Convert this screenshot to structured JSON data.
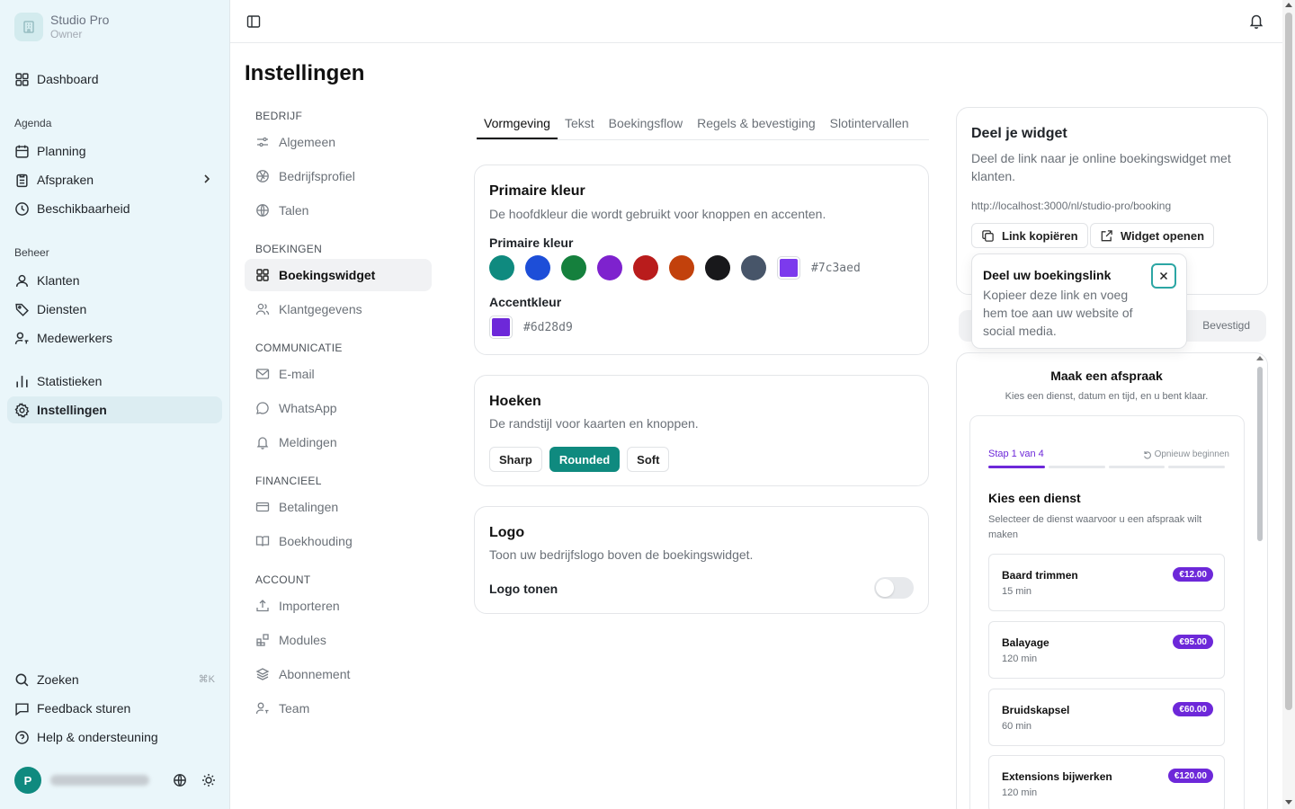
{
  "brand": {
    "name": "Studio Pro",
    "role": "Owner"
  },
  "sidebar": {
    "dashboard": "Dashboard",
    "agenda_title": "Agenda",
    "agenda": [
      "Planning",
      "Afspraken",
      "Beschikbaarheid"
    ],
    "beheer_title": "Beheer",
    "beheer": [
      "Klanten",
      "Diensten",
      "Medewerkers"
    ],
    "stats": "Statistieken",
    "settings": "Instellingen",
    "search": "Zoeken",
    "search_kbd": "⌘K",
    "feedback": "Feedback sturen",
    "help": "Help & ondersteuning",
    "user_initial": "P"
  },
  "page": {
    "title": "Instellingen"
  },
  "subnav": {
    "bedrijf": "BEDRIJF",
    "algemeen": "Algemeen",
    "bedrijfsprofiel": "Bedrijfsprofiel",
    "talen": "Talen",
    "boekingen": "BOEKINGEN",
    "boekingswidget": "Boekingswidget",
    "klantgegevens": "Klantgegevens",
    "communicatie": "COMMUNICATIE",
    "email": "E-mail",
    "whatsapp": "WhatsApp",
    "meldingen": "Meldingen",
    "financieel": "FINANCIEEL",
    "betalingen": "Betalingen",
    "boekhouding": "Boekhouding",
    "account": "ACCOUNT",
    "importeren": "Importeren",
    "modules": "Modules",
    "abonnement": "Abonnement",
    "team": "Team"
  },
  "tabs": [
    "Vormgeving",
    "Tekst",
    "Boekingsflow",
    "Regels & bevestiging",
    "Slotintervallen"
  ],
  "primary": {
    "title": "Primaire kleur",
    "desc": "De hoofdkleur die wordt gebruikt voor knoppen en accenten.",
    "label": "Primaire kleur",
    "swatches": [
      "#0f8a7f",
      "#1d4ed8",
      "#15803d",
      "#7e22ce",
      "#b91c1c",
      "#c2410c",
      "#18181b",
      "#475569"
    ],
    "custom": "#7c3aed",
    "accent_label": "Accentkleur",
    "accent": "#6d28d9"
  },
  "corners": {
    "title": "Hoeken",
    "desc": "De randstijl voor kaarten en knoppen.",
    "options": [
      "Sharp",
      "Rounded",
      "Soft"
    ],
    "selected": "Rounded"
  },
  "logo": {
    "title": "Logo",
    "desc": "Toon uw bedrijfslogo boven de boekingswidget.",
    "toggle_label": "Logo tonen",
    "enabled": false
  },
  "share": {
    "title": "Deel je widget",
    "desc": "Deel de link naar je online boekingswidget met klanten.",
    "url": "http://localhost:3000/nl/studio-pro/booking",
    "copy": "Link kopiëren",
    "open": "Widget openen"
  },
  "popover": {
    "title": "Deel uw boekingslink",
    "desc": "Kopieer deze link en voeg hem toe aan uw website of social media."
  },
  "preview_tabs": {
    "right": "Bevestigd"
  },
  "preview": {
    "title": "Maak een afspraak",
    "subtitle": "Kies een dienst, datum en tijd, en u bent klaar.",
    "step": "Stap 1 van 4",
    "restart": "Opnieuw beginnen",
    "choose": "Kies een dienst",
    "choose_desc": "Selecteer de dienst waarvoor u een afspraak wilt maken",
    "services": [
      {
        "name": "Baard trimmen",
        "duration": "15 min",
        "price": "€12.00"
      },
      {
        "name": "Balayage",
        "duration": "120 min",
        "price": "€95.00"
      },
      {
        "name": "Bruidskapsel",
        "duration": "60 min",
        "price": "€60.00"
      },
      {
        "name": "Extensions bijwerken",
        "duration": "120 min",
        "price": "€120.00"
      }
    ]
  }
}
